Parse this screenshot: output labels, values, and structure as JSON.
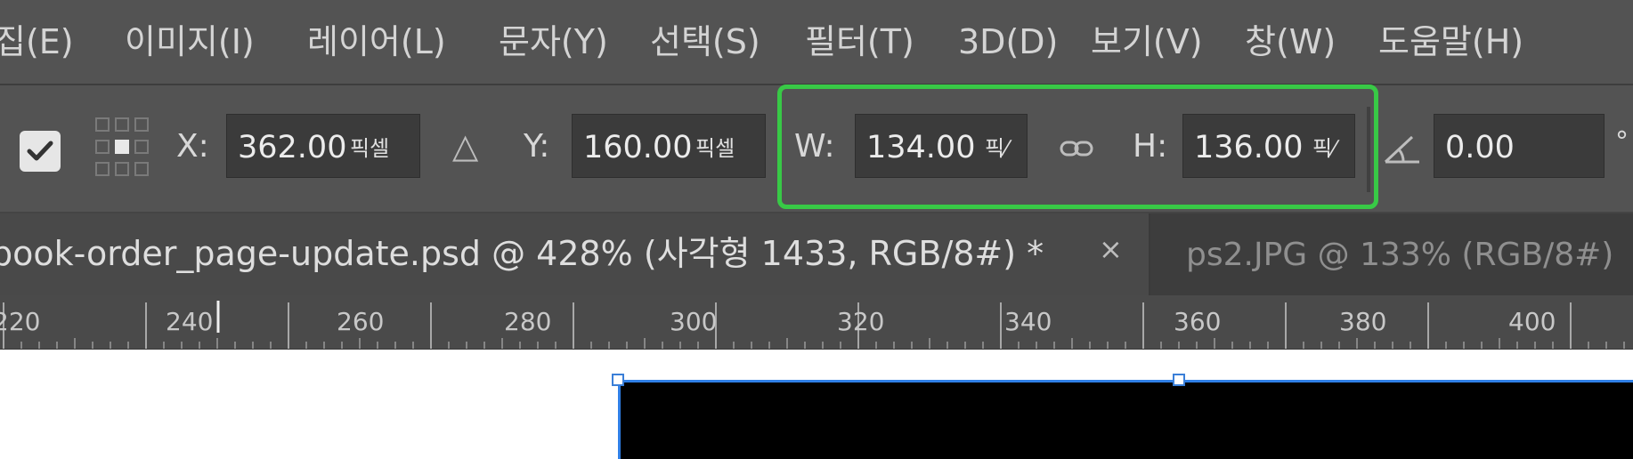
{
  "menu": {
    "items": [
      "집(E)",
      "이미지(I)",
      "레이어(L)",
      "문자(Y)",
      "선택(S)",
      "필터(T)",
      "3D(D)",
      "보기(V)",
      "창(W)",
      "도움말(H)"
    ]
  },
  "options": {
    "x_label": "X:",
    "x_value": "362.00",
    "y_label": "Y:",
    "y_value": "160.00",
    "w_label": "W:",
    "w_value": "134.00",
    "h_label": "H:",
    "h_value": "136.00",
    "unit": "픽셀",
    "unit_truncated": "픽⁄",
    "angle_value": "0.00",
    "degree": "°",
    "delta_symbol": "△",
    "link_symbol": "⊝",
    "angle_symbol": "∠"
  },
  "tabs": [
    {
      "title": "book-order_page-update.psd @ 428% (사각형 1433, RGB/8#) *",
      "close": "×",
      "active": true
    },
    {
      "title": "ps2.JPG @ 133% (RGB/8#)",
      "active": false
    }
  ],
  "ruler": {
    "labels": [
      "220",
      "240",
      "260",
      "280",
      "300",
      "320",
      "340",
      "360",
      "380",
      "400"
    ]
  },
  "colors": {
    "highlight": "#38c946",
    "selection": "#2f7fe6",
    "panel": "#535353"
  }
}
